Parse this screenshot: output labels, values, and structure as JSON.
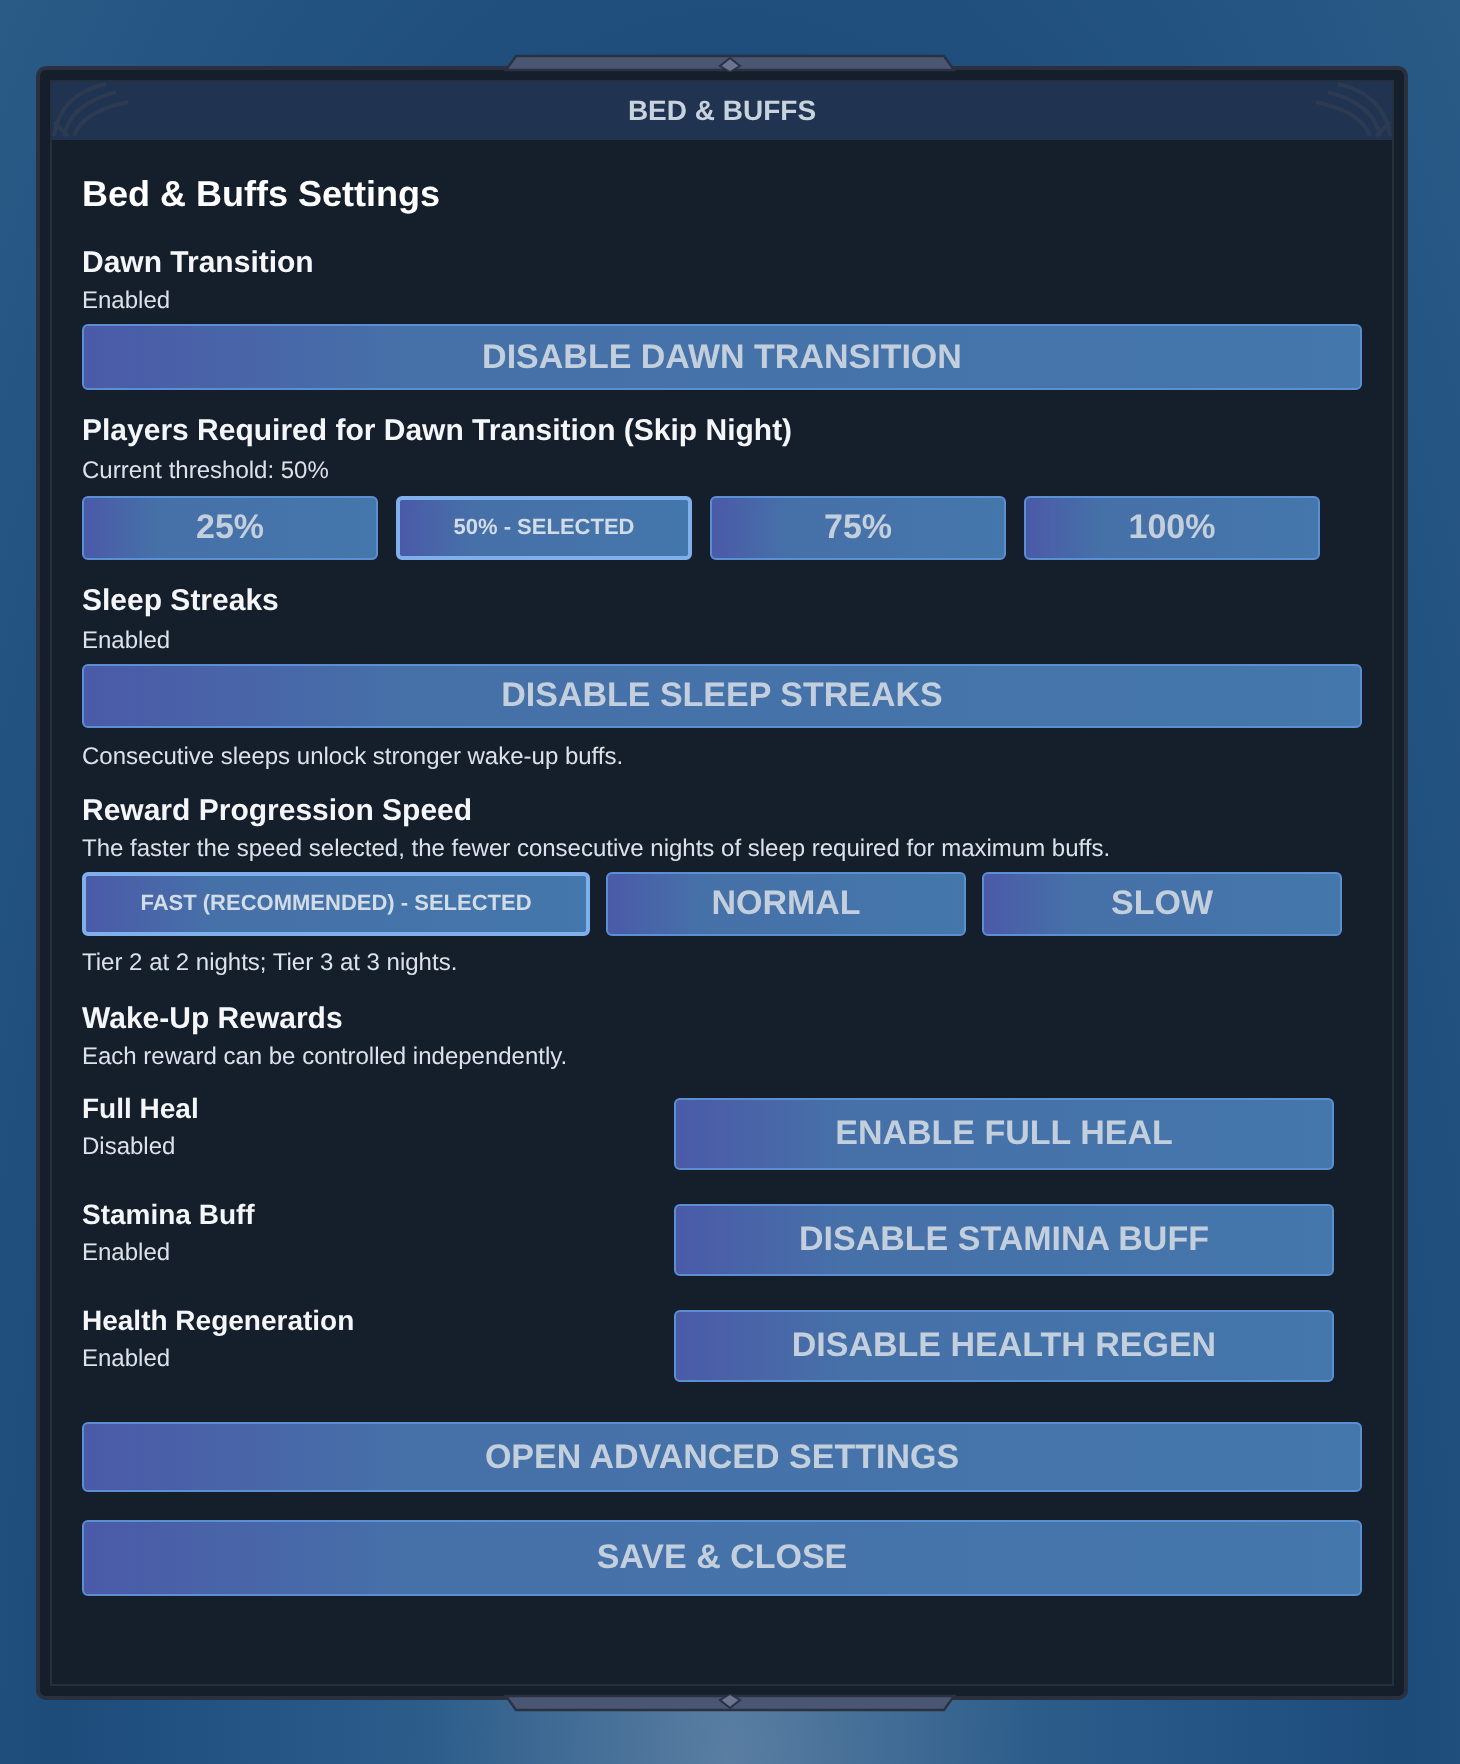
{
  "window": {
    "title": "BED & BUFFS"
  },
  "heading": "Bed & Buffs Settings",
  "dawn_transition": {
    "label": "Dawn Transition",
    "status": "Enabled",
    "button": "DISABLE DAWN TRANSITION"
  },
  "dawn_threshold": {
    "label": "Players Required for Dawn Transition (Skip Night)",
    "status": "Current threshold: 50%",
    "options": [
      {
        "label": "25%",
        "selected": false
      },
      {
        "label": "50% - SELECTED",
        "selected": true
      },
      {
        "label": "75%",
        "selected": false
      },
      {
        "label": "100%",
        "selected": false
      }
    ]
  },
  "sleep_streaks": {
    "label": "Sleep Streaks",
    "status": "Enabled",
    "button": "DISABLE SLEEP STREAKS",
    "note": "Consecutive sleeps unlock stronger wake-up buffs."
  },
  "reward_speed": {
    "label": "Reward Progression Speed",
    "description": "The faster the speed selected, the fewer consecutive nights of sleep required for maximum buffs.",
    "options": [
      {
        "label": "FAST (RECOMMENDED) - SELECTED",
        "selected": true
      },
      {
        "label": "NORMAL",
        "selected": false
      },
      {
        "label": "SLOW",
        "selected": false
      }
    ],
    "note": "Tier 2 at 2 nights; Tier 3 at 3 nights."
  },
  "wake_up_rewards": {
    "label": "Wake-Up Rewards",
    "description": "Each reward can be controlled independently.",
    "rewards": [
      {
        "label": "Full Heal",
        "status": "Disabled",
        "button": "ENABLE FULL HEAL"
      },
      {
        "label": "Stamina Buff",
        "status": "Enabled",
        "button": "DISABLE STAMINA BUFF"
      },
      {
        "label": "Health Regeneration",
        "status": "Enabled",
        "button": "DISABLE HEALTH REGEN"
      }
    ]
  },
  "actions": [
    "OPEN ADVANCED SETTINGS",
    "SAVE & CLOSE"
  ]
}
